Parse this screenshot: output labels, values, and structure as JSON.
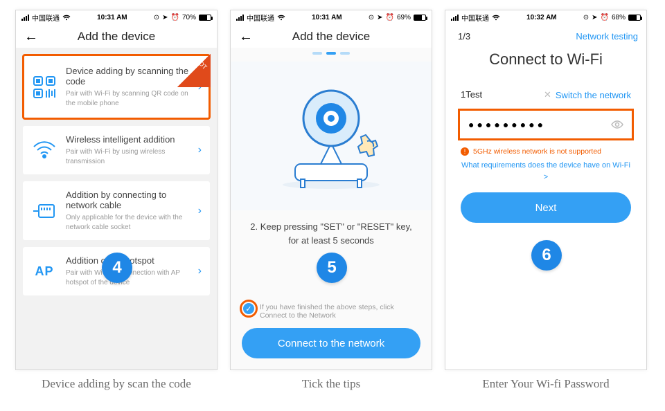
{
  "captions": {
    "p4": "Device adding by scan the code",
    "p5": "Tick the tips",
    "p6": "Enter Your Wi-fi Password"
  },
  "steps": {
    "p4": "4",
    "p5": "5",
    "p6": "6"
  },
  "panel4": {
    "status": {
      "carrier": "中国联通",
      "time": "10:31 AM",
      "battery": "70%"
    },
    "nav_title": "Add the device",
    "hot_label": "HOT",
    "cards": [
      {
        "title": "Device adding by scanning the code",
        "sub": "Pair with Wi-Fi by scanning QR code on the mobile phone"
      },
      {
        "title": "Wireless intelligent addition",
        "sub": "Pair with Wi-Fi by using wireless transmission"
      },
      {
        "title": "Addition by connecting to network cable",
        "sub": "Only applicable for the device with the network cable socket"
      },
      {
        "title": "Addition of AP hotspot",
        "sub": "Pair with Wi-Fi by connection with AP hotspot of the device"
      }
    ],
    "ap_label": "AP"
  },
  "panel5": {
    "status": {
      "carrier": "中国联通",
      "time": "10:31 AM",
      "battery": "69%"
    },
    "nav_title": "Add the device",
    "instruction": "2. Keep pressing \"SET\" or \"RESET\" key, for at least 5 seconds",
    "check_text": "If you have finished the above steps, click Connect to the Network",
    "connect_btn": "Connect to the network"
  },
  "panel6": {
    "status": {
      "carrier": "中国联通",
      "time": "10:32 AM",
      "battery": "68%"
    },
    "nav_counter": "1/3",
    "nav_action": "Network testing",
    "title": "Connect to Wi-Fi",
    "ssid": "1Test",
    "switch_label": "Switch the network",
    "password_mask": "●●●●●●●●●",
    "warn": "5GHz wireless network is not supported",
    "req_link": "What requirements does the device have on Wi-Fi >",
    "next_btn": "Next"
  }
}
